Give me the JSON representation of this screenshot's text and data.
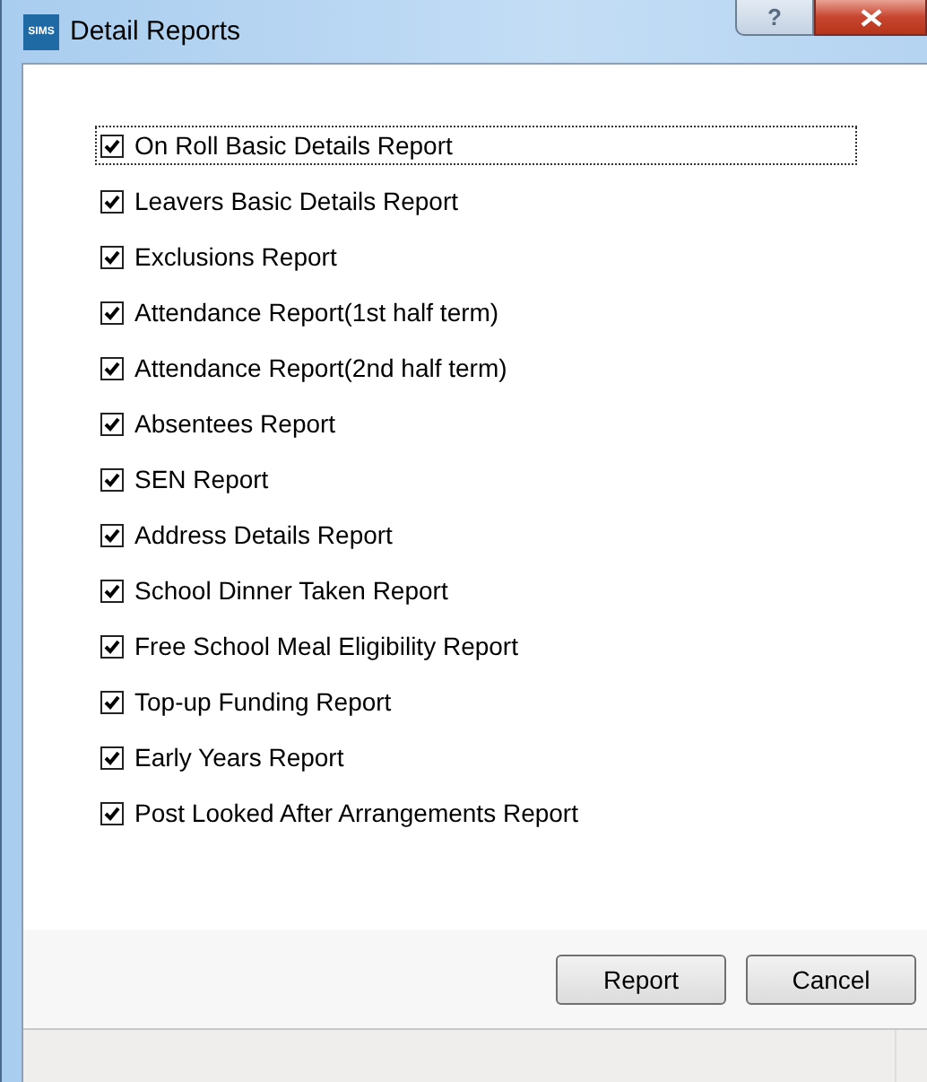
{
  "window": {
    "app_icon": "SIMS",
    "title": "Detail Reports",
    "help_button": "?"
  },
  "reports": [
    {
      "label": "On Roll Basic Details Report",
      "checked": true,
      "focused": true
    },
    {
      "label": "Leavers Basic Details Report",
      "checked": true,
      "focused": false
    },
    {
      "label": "Exclusions Report",
      "checked": true,
      "focused": false
    },
    {
      "label": "Attendance Report(1st half term)",
      "checked": true,
      "focused": false
    },
    {
      "label": "Attendance Report(2nd half term)",
      "checked": true,
      "focused": false
    },
    {
      "label": "Absentees Report",
      "checked": true,
      "focused": false
    },
    {
      "label": "SEN Report",
      "checked": true,
      "focused": false
    },
    {
      "label": "Address Details Report",
      "checked": true,
      "focused": false
    },
    {
      "label": "School Dinner Taken Report",
      "checked": true,
      "focused": false
    },
    {
      "label": "Free School Meal Eligibility Report",
      "checked": true,
      "focused": false
    },
    {
      "label": "Top-up Funding Report",
      "checked": true,
      "focused": false
    },
    {
      "label": "Early Years Report",
      "checked": true,
      "focused": false
    },
    {
      "label": "Post Looked After Arrangements Report",
      "checked": true,
      "focused": false
    }
  ],
  "buttons": [
    "Report",
    "Cancel"
  ]
}
